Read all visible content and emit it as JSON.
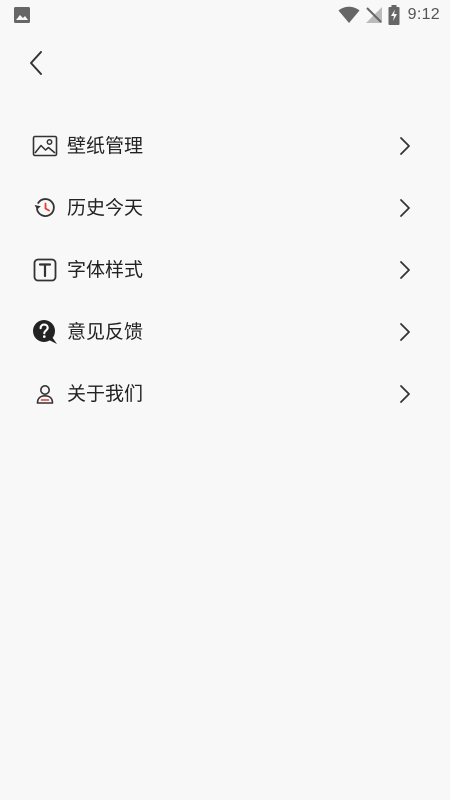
{
  "status_bar": {
    "time": "9:12",
    "left_icon": "image-notification-icon",
    "right_icons": [
      "wifi-icon",
      "no-signal-icon",
      "battery-charging-icon"
    ]
  },
  "header": {
    "back_icon": "chevron-left-icon"
  },
  "menu": {
    "items": [
      {
        "label": "壁纸管理",
        "icon": "wallpaper-icon"
      },
      {
        "label": "历史今天",
        "icon": "history-icon"
      },
      {
        "label": "字体样式",
        "icon": "font-style-icon"
      },
      {
        "label": "意见反馈",
        "icon": "feedback-icon"
      },
      {
        "label": "关于我们",
        "icon": "about-us-icon"
      }
    ],
    "chevron_icon": "chevron-right-icon"
  },
  "colors": {
    "background": "#f8f8f8",
    "text": "#222222",
    "icon": "#333333",
    "accent_red": "#e53935",
    "status_icon": "#666666"
  }
}
